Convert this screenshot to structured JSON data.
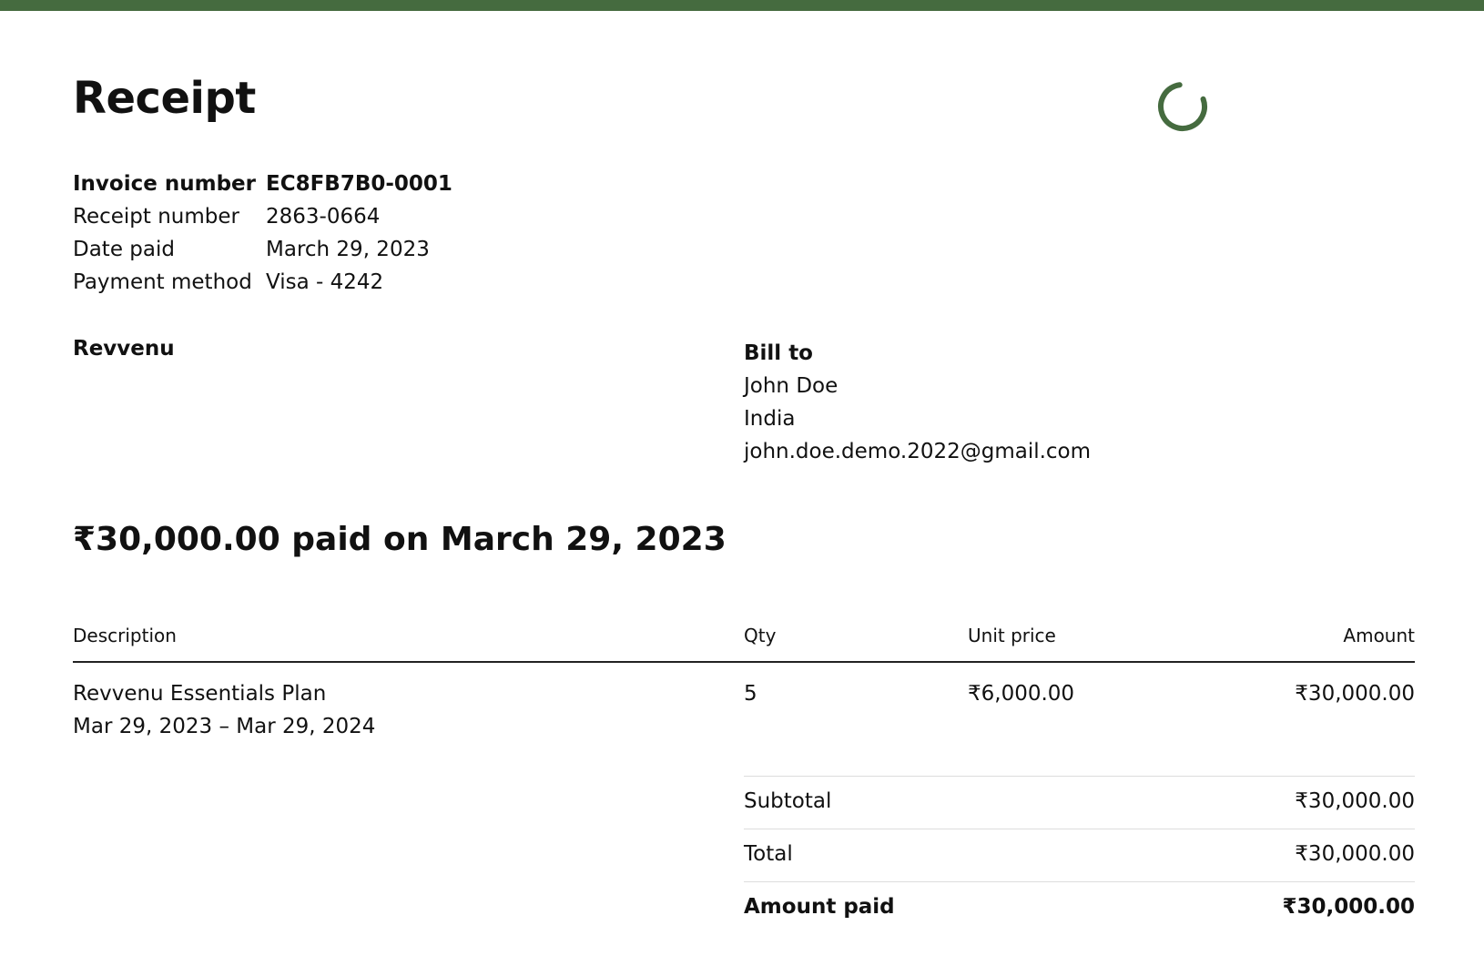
{
  "receipt": {
    "title": "Receipt",
    "meta": [
      {
        "label": "Invoice number",
        "value": "EC8FB7B0-0001",
        "bold": true
      },
      {
        "label": "Receipt number",
        "value": "2863-0664",
        "bold": false
      },
      {
        "label": "Date paid",
        "value": "March 29, 2023",
        "bold": false
      },
      {
        "label": "Payment method",
        "value": "Visa - 4242",
        "bold": false
      }
    ],
    "from": {
      "name": "Revvenu"
    },
    "bill_to": {
      "heading": "Bill to",
      "name": "John Doe",
      "country": "India",
      "email": "john.doe.demo.2022@gmail.com"
    },
    "paid_headline": "₹30,000.00 paid on March 29, 2023",
    "table": {
      "headers": {
        "description": "Description",
        "qty": "Qty",
        "unit_price": "Unit price",
        "amount": "Amount"
      },
      "items": [
        {
          "description": "Revvenu Essentials Plan",
          "period": "Mar 29, 2023 – Mar 29, 2024",
          "qty": "5",
          "unit_price": "₹6,000.00",
          "amount": "₹30,000.00"
        }
      ]
    },
    "totals": {
      "subtotal_label": "Subtotal",
      "subtotal_value": "₹30,000.00",
      "total_label": "Total",
      "total_value": "₹30,000.00",
      "amount_paid_label": "Amount paid",
      "amount_paid_value": "₹30,000.00"
    }
  },
  "colors": {
    "accent": "#456b3f",
    "text": "#111111",
    "divider": "#dddddd"
  },
  "icons": {
    "spinner": "loading-spinner-icon"
  }
}
